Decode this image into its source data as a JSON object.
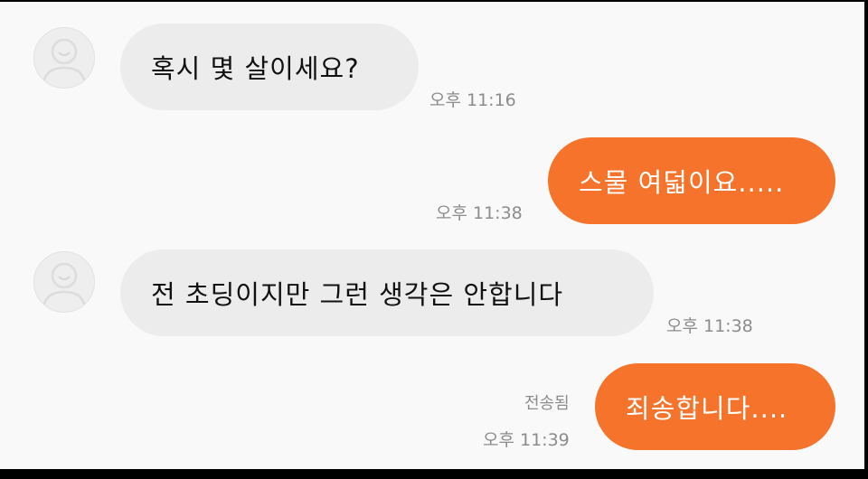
{
  "chat": {
    "colors": {
      "incoming_bubble": "#ececec",
      "outgoing_bubble": "#f5732a",
      "background": "#f9f9f9",
      "timestamp": "#8c8c8c"
    },
    "messages": [
      {
        "direction": "incoming",
        "avatar_icon": "default-profile-icon",
        "text": "혹시 몇 살이세요?",
        "time": "오후 11:16"
      },
      {
        "direction": "outgoing",
        "text": "스물 여덟이요.....",
        "time": "오후 11:38"
      },
      {
        "direction": "incoming",
        "avatar_icon": "default-profile-icon",
        "text": "전 초딩이지만 그런 생각은 안합니다",
        "time": "오후 11:38"
      },
      {
        "direction": "outgoing",
        "text": "죄송합니다....",
        "status": "전송됨",
        "time": "오후 11:39"
      }
    ]
  }
}
